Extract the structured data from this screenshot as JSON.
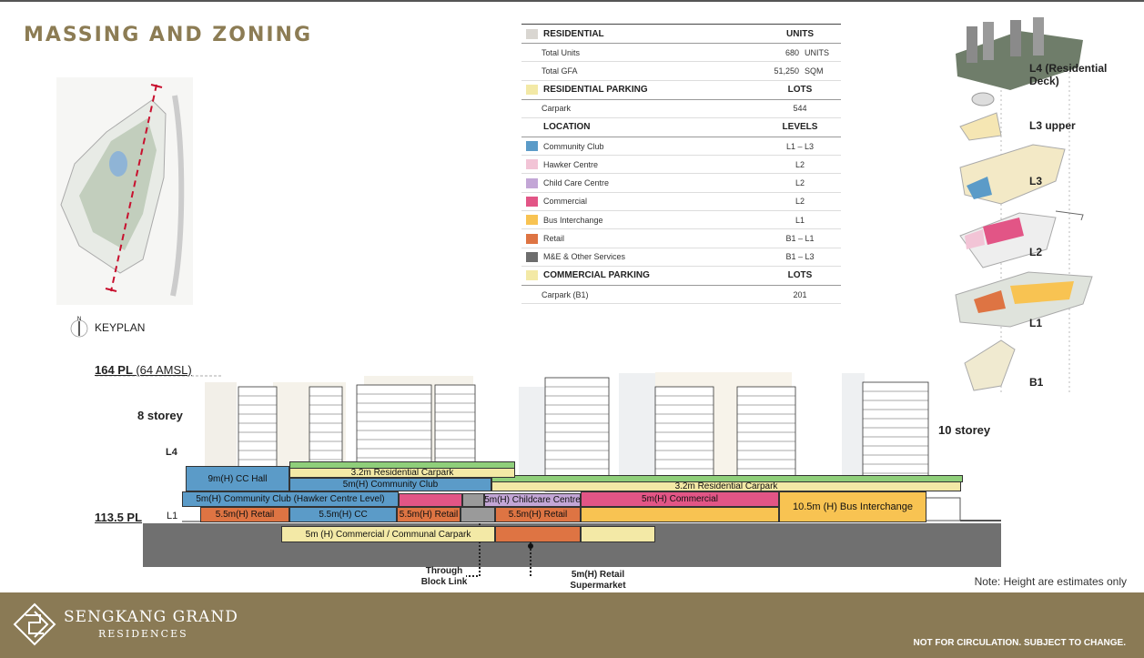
{
  "title": "MASSING AND ZONING",
  "keyplan_label": "KEYPLAN",
  "north_label": "N",
  "table": {
    "residential": {
      "header": "RESIDENTIAL",
      "col": "UNITS",
      "color": "#d9d6d1",
      "rows": [
        {
          "label": "Total Units",
          "value": "680",
          "unit": "UNITS"
        },
        {
          "label": "Total GFA",
          "value": "51,250",
          "unit": "SQM"
        }
      ]
    },
    "residential_parking": {
      "header": "RESIDENTIAL PARKING",
      "col": "LOTS",
      "color": "#f3e9a6",
      "rows": [
        {
          "label": "Carpark",
          "value": "544"
        }
      ]
    },
    "location": {
      "header": "LOCATION",
      "col": "LEVELS",
      "rows": [
        {
          "label": "Community Club",
          "value": "L1 – L3",
          "color": "#5b9bc8"
        },
        {
          "label": "Hawker Centre",
          "value": "L2",
          "color": "#f2c4d6"
        },
        {
          "label": "Child Care Centre",
          "value": "L2",
          "color": "#c3a6d6"
        },
        {
          "label": "Commercial",
          "value": "L2",
          "color": "#e25586"
        },
        {
          "label": "Bus Interchange",
          "value": "L1",
          "color": "#f8c352"
        },
        {
          "label": "Retail",
          "value": "B1 – L1",
          "color": "#de7443"
        },
        {
          "label": "M&E & Other Services",
          "value": "B1 – L3",
          "color": "#6d6d6d"
        }
      ]
    },
    "commercial_parking": {
      "header": "COMMERCIAL PARKING",
      "col": "LOTS",
      "color": "#f3e9a6",
      "rows": [
        {
          "label": "Carpark (B1)",
          "value": "201"
        }
      ]
    }
  },
  "levels": [
    "L4 (Residential Deck)",
    "L3 upper",
    "L3",
    "L2",
    "L1",
    "B1"
  ],
  "section": {
    "pl_top": "164 PL",
    "pl_top_amsl": "(64 AMSL)",
    "pl_ground": "113.5 PL",
    "l1": "L1",
    "l4": "L4",
    "storey_left": "8 storey",
    "storey_right": "10 storey",
    "blocks": {
      "cc_hall": "9m(H) CC Hall",
      "res_carpark_a": "3.2m Residential Carpark",
      "res_carpark_b": "3.2m Residential Carpark",
      "cc_l3": "5m(H) Community Club",
      "cc_hawker": "5m(H) Community Club (Hawker Centre Level)",
      "childcare": "5m(H) Childcare Centre",
      "commercial": "5m(H) Commercial",
      "bus": "10.5m (H) Bus Interchange",
      "retail_a": "5.5m(H) Retail",
      "cc_l1": "5.5m(H) CC",
      "retail_b": "5.5m(H) Retail",
      "retail_c": "5.5m(H) Retail",
      "b1_carpark": "5m (H) Commercial / Communal Carpark"
    },
    "annotations": {
      "through_link": "Through\nBlock Link",
      "supermarket": "5m(H) Retail\nSupermarket"
    }
  },
  "note": "Note: Height are estimates only",
  "brand": {
    "name": "SENGKANG GRAND",
    "sub": "RESIDENCES"
  },
  "disclaimer": "NOT FOR CIRCULATION. SUBJECT TO CHANGE."
}
